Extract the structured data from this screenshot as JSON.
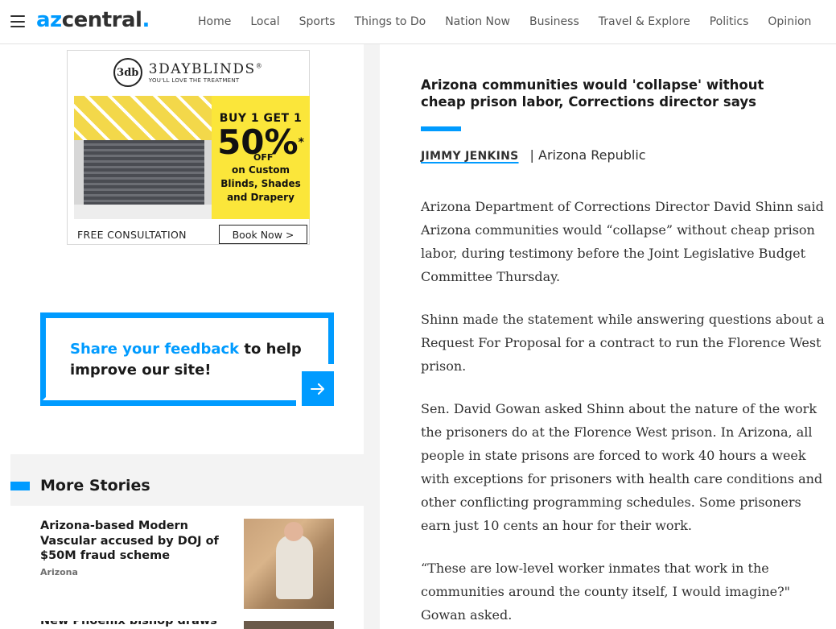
{
  "header": {
    "logo_az": "az",
    "logo_central": "central",
    "logo_dot": ".",
    "nav": [
      "Home",
      "Local",
      "Sports",
      "Things to Do",
      "Nation Now",
      "Business",
      "Travel & Explore",
      "Politics",
      "Opinion"
    ]
  },
  "ad": {
    "brand_mark": "3db",
    "brand_name": "3DAYBLINDS",
    "brand_reg": "®",
    "tagline": "YOU'LL LOVE THE TREATMENT",
    "offer_line1": "BUY 1 GET 1",
    "offer_percent": "50%",
    "offer_asterisk": "*",
    "offer_off": "OFF",
    "offer_line3a": "on Custom",
    "offer_line3b": "Blinds, Shades",
    "offer_line3c": "and Drapery",
    "free_consultation": "FREE CONSULTATION",
    "book_now": "Book Now >"
  },
  "feedback": {
    "link_text": "Share your feedback",
    "rest_text": " to help improve our site!",
    "arrow_icon": "arrow-right-icon"
  },
  "more_stories": {
    "title": "More Stories",
    "items": [
      {
        "headline": "Arizona-based Modern Vascular accused by DOJ of $50M fraud scheme",
        "tag": "Arizona"
      },
      {
        "headline": "New Phoenix bishop draws",
        "tag": ""
      }
    ]
  },
  "article": {
    "title": "Arizona communities would 'collapse' without cheap prison labor, Corrections director says",
    "author": "JIMMY JENKINS",
    "publication": "| Arizona Republic",
    "paragraphs": [
      "Arizona Department of Corrections Director David Shinn said Arizona communities would “collapse” without cheap prison labor, during testimony before the Joint Legislative Budget Committee Thursday.",
      "Shinn made the statement while answering questions about a Request For Proposal for a contract to run the Florence West prison.",
      "Sen. David Gowan asked Shinn about the nature of the work the prisoners do at the Florence West prison. In Arizona, all people in state prisons are forced to work 40 hours a week with exceptions for prisoners with health care conditions and other conflicting programming schedules. Some prisoners earn just 10 cents an hour for their work.",
      "“These are low-level worker inmates that work in the communities around the county itself, I would imagine?\" Gowan asked."
    ]
  },
  "colors": {
    "accent": "#009bff",
    "text": "#303030"
  }
}
